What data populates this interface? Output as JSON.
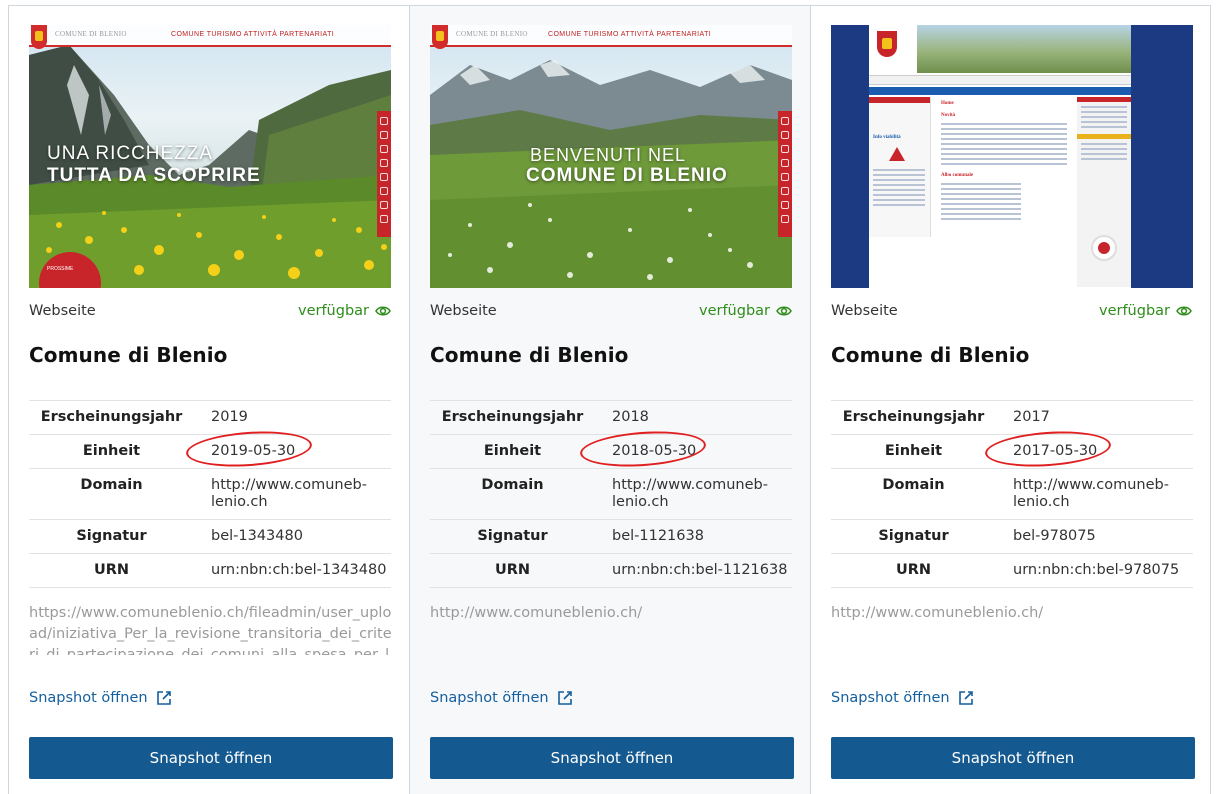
{
  "labels": {
    "type": "Webseite",
    "status": "verfügbar",
    "erscheinungsjahr": "Erscheinungsjahr",
    "einheit": "Einheit",
    "domain": "Domain",
    "signatur": "Signatur",
    "urn": "URN",
    "snapshot_link": "Snapshot öffnen",
    "snapshot_button": "Snapshot öffnen"
  },
  "colors": {
    "status_green": "#2e8d1c",
    "link_blue": "#145f9e",
    "button_blue": "#14598f",
    "annotation_red": "#e02020"
  },
  "icons": {
    "status": "eye-icon",
    "link": "external-link-icon"
  },
  "cards": [
    {
      "title": "Comune di Blenio",
      "year": "2019",
      "unit": "2019-05-30",
      "domain": "http://www.comuneb-lenio.ch",
      "signature": "bel-1343480",
      "urn": "urn:nbn:ch:bel-1343480",
      "url": "https://www.comuneblenio.ch/fileadmin/user_upload/iniziativa_Per_la_revisione_transitoria_dei_criteri_di_partecipazione_dei_comuni_alla_spesa_per_l",
      "thumb": {
        "brand": "COMUNE DI BLENIO",
        "nav": "COMUNE   TURISMO   ATTIVITÀ   PARTENARIATI",
        "line1": "UNA RICCHEZZA",
        "line2": "TUTTA DA SCOPRIRE",
        "badge": "PROSSIME"
      }
    },
    {
      "title": "Comune di Blenio",
      "year": "2018",
      "unit": "2018-05-30",
      "domain": "http://www.comuneb-lenio.ch",
      "signature": "bel-1121638",
      "urn": "urn:nbn:ch:bel-1121638",
      "url": "http://www.comuneblenio.ch/",
      "thumb": {
        "brand": "COMUNE DI BLENIO",
        "nav": "COMUNE   TURISMO   ATTIVITÀ   PARTENARIATI",
        "line1": "BENVENUTI NEL",
        "line2": "COMUNE DI BLENIO"
      }
    },
    {
      "title": "Comune di Blenio",
      "year": "2017",
      "unit": "2017-05-30",
      "domain": "http://www.comuneb-lenio.ch",
      "signature": "bel-978075",
      "urn": "urn:nbn:ch:bel-978075",
      "url": "http://www.comuneblenio.ch/",
      "thumb": {
        "h1": "Home",
        "h2": "Novità",
        "h3": "Info viabilità",
        "h4": "Albo comunale"
      }
    }
  ]
}
